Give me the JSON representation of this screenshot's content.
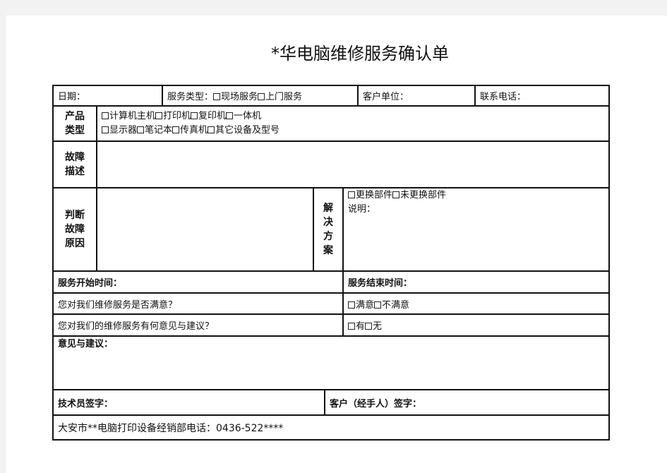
{
  "title": "*华电脑维修服务确认单",
  "header_row": {
    "date_label": "日期：",
    "service_type_label": "服务类型：",
    "service_type_options": [
      "现场服务",
      "上门服务"
    ],
    "customer_unit_label": "客户单位：",
    "phone_label": "联系电话："
  },
  "product_type": {
    "label_line1": "产品",
    "label_line2": "类型",
    "options_line1": [
      "计算机主机",
      "打印机",
      "复印机",
      "一体机"
    ],
    "options_line2": [
      "显示器",
      "笔记本",
      "传真机",
      "其它设备及型号"
    ]
  },
  "fault_description": {
    "label_line1": "故障",
    "label_line2": "描述",
    "value": ""
  },
  "fault_cause": {
    "label_line1": "判断",
    "label_line2": "故障",
    "label_line3": "原因",
    "value": ""
  },
  "solution": {
    "label_chars": [
      "解",
      "决",
      "方",
      "案"
    ],
    "options": [
      "更换部件",
      "未更换部件"
    ],
    "note_label": "说明："
  },
  "service_time": {
    "start_label": "服务开始时间：",
    "end_label": "服务结束时间："
  },
  "satisfaction": {
    "question": "您对我们维修服务是否满意？",
    "options": [
      "满意",
      "不满意"
    ]
  },
  "feedback_question": {
    "question": "您对我们的维修服务有何意见与建议？",
    "options": [
      "有",
      "无"
    ]
  },
  "suggestions": {
    "label": "意见与建议：",
    "value": ""
  },
  "signatures": {
    "technician_label": "技术员签字：",
    "customer_label": "客户（经手人）签字："
  },
  "footer": {
    "text": "大安市**电脑打印设备经销部电话：0436-522****"
  }
}
